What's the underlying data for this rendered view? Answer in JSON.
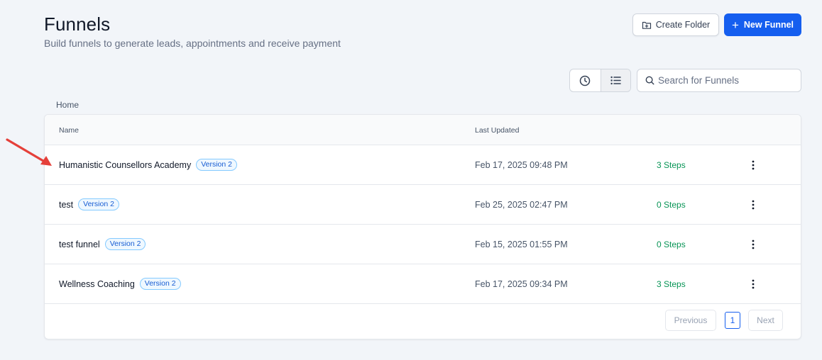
{
  "header": {
    "title": "Funnels",
    "subtitle": "Build funnels to generate leads, appointments and receive payment",
    "create_folder_label": "Create Folder",
    "new_funnel_label": "New Funnel"
  },
  "toolbar": {
    "view_options": [
      "clock-icon",
      "list-icon"
    ],
    "active_view": "list",
    "search_placeholder": "Search for Funnels"
  },
  "breadcrumb": "Home",
  "table": {
    "columns": [
      "Name",
      "Last Updated"
    ],
    "rows": [
      {
        "name": "Humanistic Counsellors Academy",
        "version": "Version 2",
        "updated": "Feb 17, 2025 09:48 PM",
        "steps": "3 Steps"
      },
      {
        "name": "test",
        "version": "Version 2",
        "updated": "Feb 25, 2025 02:47 PM",
        "steps": "0 Steps"
      },
      {
        "name": "test funnel",
        "version": "Version 2",
        "updated": "Feb 15, 2025 01:55 PM",
        "steps": "0 Steps"
      },
      {
        "name": "Wellness Coaching",
        "version": "Version 2",
        "updated": "Feb 17, 2025 09:34 PM",
        "steps": "3 Steps"
      }
    ]
  },
  "pagination": {
    "previous_label": "Previous",
    "current_page": "1",
    "next_label": "Next"
  },
  "colors": {
    "primary": "#155eef",
    "steps_green": "#079455",
    "badge_blue": "#175cd3",
    "annotation_red": "#e5403a"
  }
}
